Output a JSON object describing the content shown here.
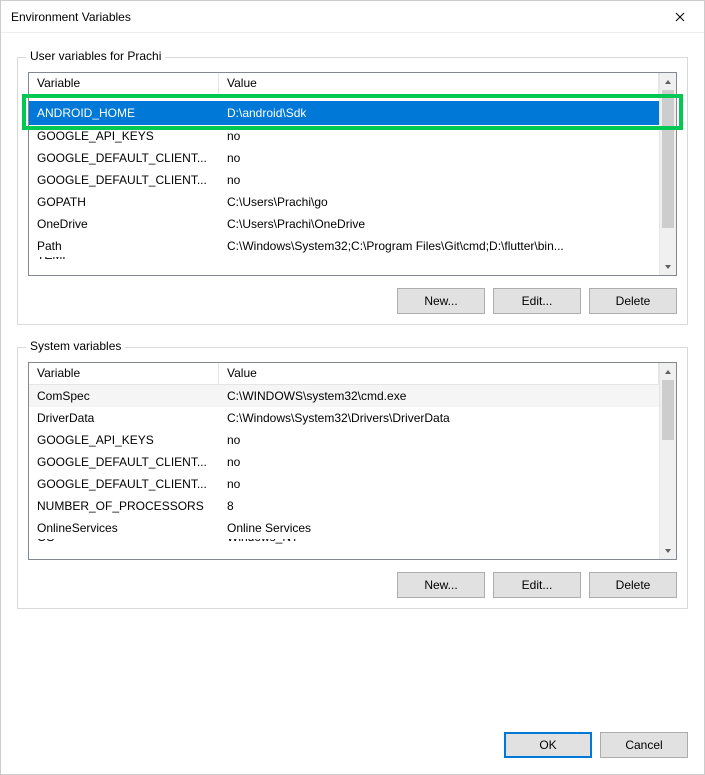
{
  "window": {
    "title": "Environment Variables"
  },
  "userGroup": {
    "legend": "User variables for Prachi",
    "columns": {
      "variable": "Variable",
      "value": "Value"
    },
    "rows": [
      {
        "variable": "ANDROID_HOME",
        "value": "D:\\android\\Sdk",
        "selected": true
      },
      {
        "variable": "GOOGLE_API_KEYS",
        "value": "no"
      },
      {
        "variable": "GOOGLE_DEFAULT_CLIENT...",
        "value": "no"
      },
      {
        "variable": "GOOGLE_DEFAULT_CLIENT...",
        "value": "no"
      },
      {
        "variable": "GOPATH",
        "value": "C:\\Users\\Prachi\\go"
      },
      {
        "variable": "OneDrive",
        "value": "C:\\Users\\Prachi\\OneDrive"
      },
      {
        "variable": "Path",
        "value": "C:\\Windows\\System32;C:\\Program Files\\Git\\cmd;D:\\flutter\\bin..."
      },
      {
        "variable": "TEMP",
        "value": ""
      }
    ],
    "buttons": {
      "new": "New...",
      "edit": "Edit...",
      "delete": "Delete"
    }
  },
  "systemGroup": {
    "legend": "System variables",
    "columns": {
      "variable": "Variable",
      "value": "Value"
    },
    "rows": [
      {
        "variable": "ComSpec",
        "value": "C:\\WINDOWS\\system32\\cmd.exe",
        "alt": true
      },
      {
        "variable": "DriverData",
        "value": "C:\\Windows\\System32\\Drivers\\DriverData"
      },
      {
        "variable": "GOOGLE_API_KEYS",
        "value": "no"
      },
      {
        "variable": "GOOGLE_DEFAULT_CLIENT...",
        "value": "no"
      },
      {
        "variable": "GOOGLE_DEFAULT_CLIENT...",
        "value": "no"
      },
      {
        "variable": "NUMBER_OF_PROCESSORS",
        "value": "8"
      },
      {
        "variable": "OnlineServices",
        "value": "Online Services"
      },
      {
        "variable": "OS",
        "value": "Windows_NT"
      }
    ],
    "buttons": {
      "new": "New...",
      "edit": "Edit...",
      "delete": "Delete"
    }
  },
  "dialogButtons": {
    "ok": "OK",
    "cancel": "Cancel"
  }
}
